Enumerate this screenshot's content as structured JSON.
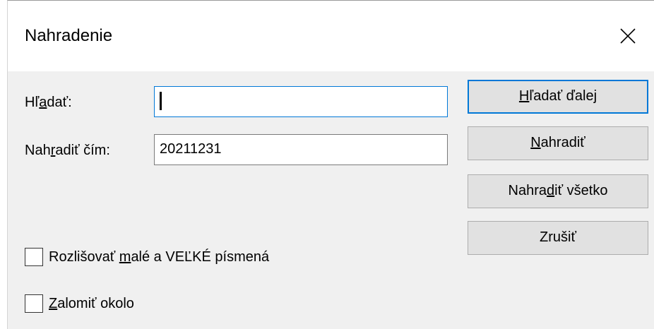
{
  "window": {
    "title": "Nahradenie",
    "close_icon": "close-icon"
  },
  "form": {
    "find": {
      "label_pre": "Hľ",
      "label_accel": "a",
      "label_post": "dať:",
      "value": ""
    },
    "replace": {
      "label_pre": "Nah",
      "label_accel": "r",
      "label_post": "adiť čím:",
      "value": "20211231"
    }
  },
  "buttons": {
    "find_next": {
      "pre": "",
      "accel": "H",
      "post": "ľadať ďalej"
    },
    "replace": {
      "pre": "",
      "accel": "N",
      "post": "ahradiť"
    },
    "replace_all": {
      "pre": "Nahra",
      "accel": "d",
      "post": "iť všetko"
    },
    "cancel": {
      "pre": "Zrušiť",
      "accel": "",
      "post": ""
    }
  },
  "options": {
    "match_case": {
      "pre": "Rozlišovať ",
      "accel": "m",
      "post": "alé a VEĽKÉ písmená",
      "checked": false
    },
    "wrap_around": {
      "pre": "",
      "accel": "Z",
      "post": "alomiť okolo",
      "checked": false
    }
  },
  "colors": {
    "accent": "#0078d7",
    "dialog_bg": "#f0f0f0",
    "button_bg": "#e1e1e1"
  }
}
